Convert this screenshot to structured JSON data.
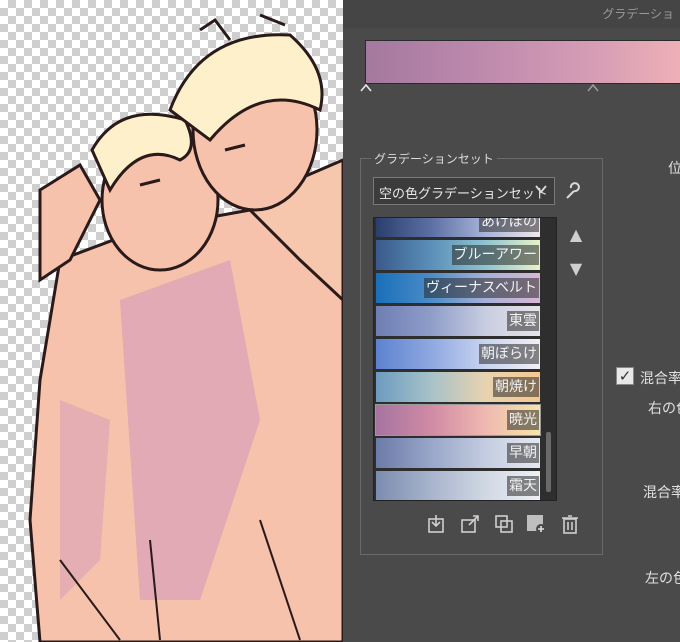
{
  "panel": {
    "title": "グラデーショ",
    "gradient_set_group_label": "グラデーションセット",
    "preset_select": {
      "value": "空の色グラデーションセット",
      "arrow": "chevron-down-icon"
    },
    "gradients": [
      {
        "name": "あけぼの",
        "stops": [
          "#2b3f6e",
          "#5c6fa3",
          "#a8b3d8",
          "#f0e6ee"
        ]
      },
      {
        "name": "ブルーアワー",
        "stops": [
          "#3a5a8c",
          "#5a8fb8",
          "#8fc3d0",
          "#e9f2c8"
        ]
      },
      {
        "name": "ヴィーナスベルト",
        "stops": [
          "#1a6fb8",
          "#4a8cc8",
          "#a6b0d8",
          "#d9b8d4"
        ]
      },
      {
        "name": "東雲",
        "stops": [
          "#6f7fb4",
          "#8e9cc8",
          "#c8cde0",
          "#e6e3ea"
        ]
      },
      {
        "name": "朝ぼらけ",
        "stops": [
          "#5d82d0",
          "#8ea8e0",
          "#c8d4f0",
          "#f2eef4"
        ]
      },
      {
        "name": "朝焼け",
        "stops": [
          "#6d9bbf",
          "#a6c2c8",
          "#e8d2b0",
          "#f5c890"
        ]
      },
      {
        "name": "暁光",
        "stops": [
          "#a674a0",
          "#d08aa4",
          "#efb8b0",
          "#f6e5a8"
        ]
      },
      {
        "name": "早朝",
        "stops": [
          "#6c7ba8",
          "#98a6c8",
          "#c4cce0",
          "#e4e8f0"
        ]
      },
      {
        "name": "霜天",
        "stops": [
          "#7c8cb0",
          "#a8b4cc",
          "#d0d8e4",
          "#eef0f4"
        ]
      }
    ],
    "right_labels": {
      "position": "位",
      "blend_checkbox": "混合率",
      "right_color": "右の色",
      "blend": "混合率",
      "left_color": "左の色"
    },
    "bar_colors": {
      "start": "#a4789f",
      "end": "#f0b2b6"
    }
  }
}
